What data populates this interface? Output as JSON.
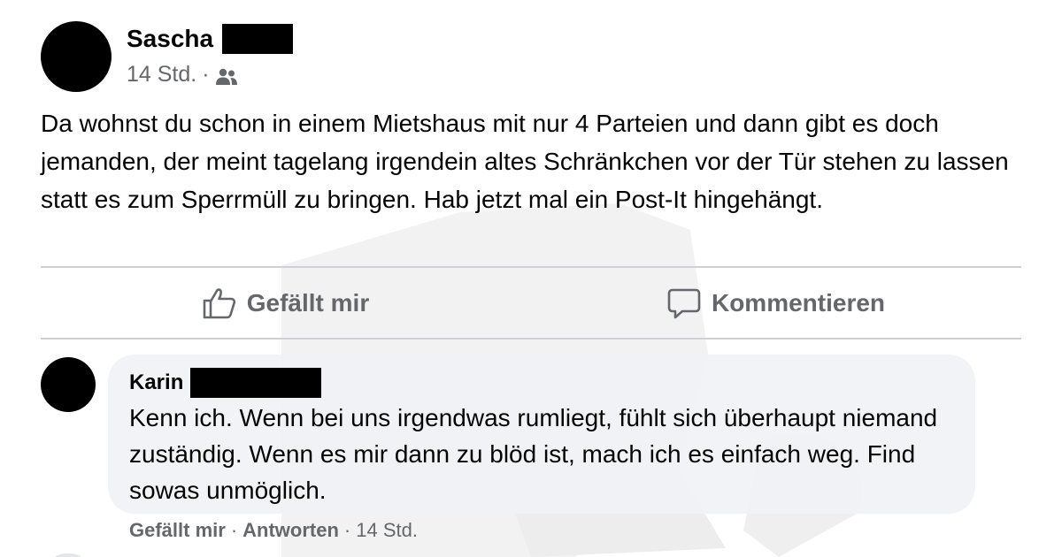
{
  "post": {
    "author": "Sascha",
    "time": "14 Std.",
    "separator": "·",
    "audience_icon": "friends-icon",
    "text": "Da wohnst du schon in einem Mietshaus mit nur 4 Parteien und dann gibt es doch jemanden, der meint tagelang irgendein altes Schränkchen vor der Tür stehen zu lassen statt es zum Sperrmüll zu bringen. Hab jetzt mal ein Post-It hingehängt."
  },
  "actions": {
    "like_label": "Gefällt mir",
    "like_icon": "thumbs-up-icon",
    "comment_label": "Kommentieren",
    "comment_icon": "speech-bubble-icon"
  },
  "comment": {
    "author": "Karin",
    "text": "Kenn ich. Wenn bei uns irgendwas rumliegt, fühlt sich überhaupt niemand zuständig. Wenn es mir dann zu blöd ist, mach ich es einfach weg. Find sowas unmöglich.",
    "like_label": "Gefällt mir",
    "reply_label": "Antworten",
    "separator": "·",
    "time": "14 Std."
  },
  "colors": {
    "text": "#050505",
    "secondary": "#65676b",
    "divider": "#ced0d4",
    "bubble": "#f0f2f5",
    "redaction": "#000000"
  }
}
